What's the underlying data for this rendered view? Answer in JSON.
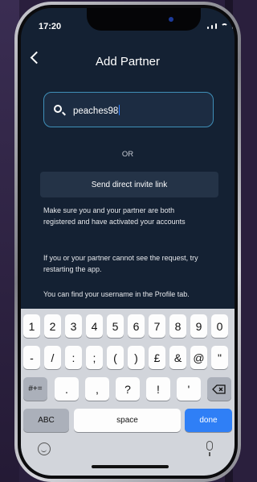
{
  "status": {
    "time": "17:20"
  },
  "header": {
    "title": "Add Partner"
  },
  "search": {
    "value": "peaches98"
  },
  "divider": {
    "or": "OR"
  },
  "invite": {
    "label": "Send direct invite link"
  },
  "info": [
    "Make sure you and your partner are both registered and have activated your accounts",
    "If you or your partner cannot see the request, try restarting the app.",
    "You can find your username in the Profile tab."
  ],
  "keyboard": {
    "row1": [
      "1",
      "2",
      "3",
      "4",
      "5",
      "6",
      "7",
      "8",
      "9",
      "0"
    ],
    "row2": [
      "-",
      "/",
      ":",
      ";",
      "(",
      ")",
      "£",
      "&",
      "@",
      "\""
    ],
    "symbols_toggle": "#+=",
    "row3": [
      ".",
      ",",
      "?",
      "!",
      "'"
    ],
    "delete_icon": "backspace-icon",
    "abc": "ABC",
    "space": "space",
    "done": "done",
    "accent_color": "#2f7ff6"
  }
}
